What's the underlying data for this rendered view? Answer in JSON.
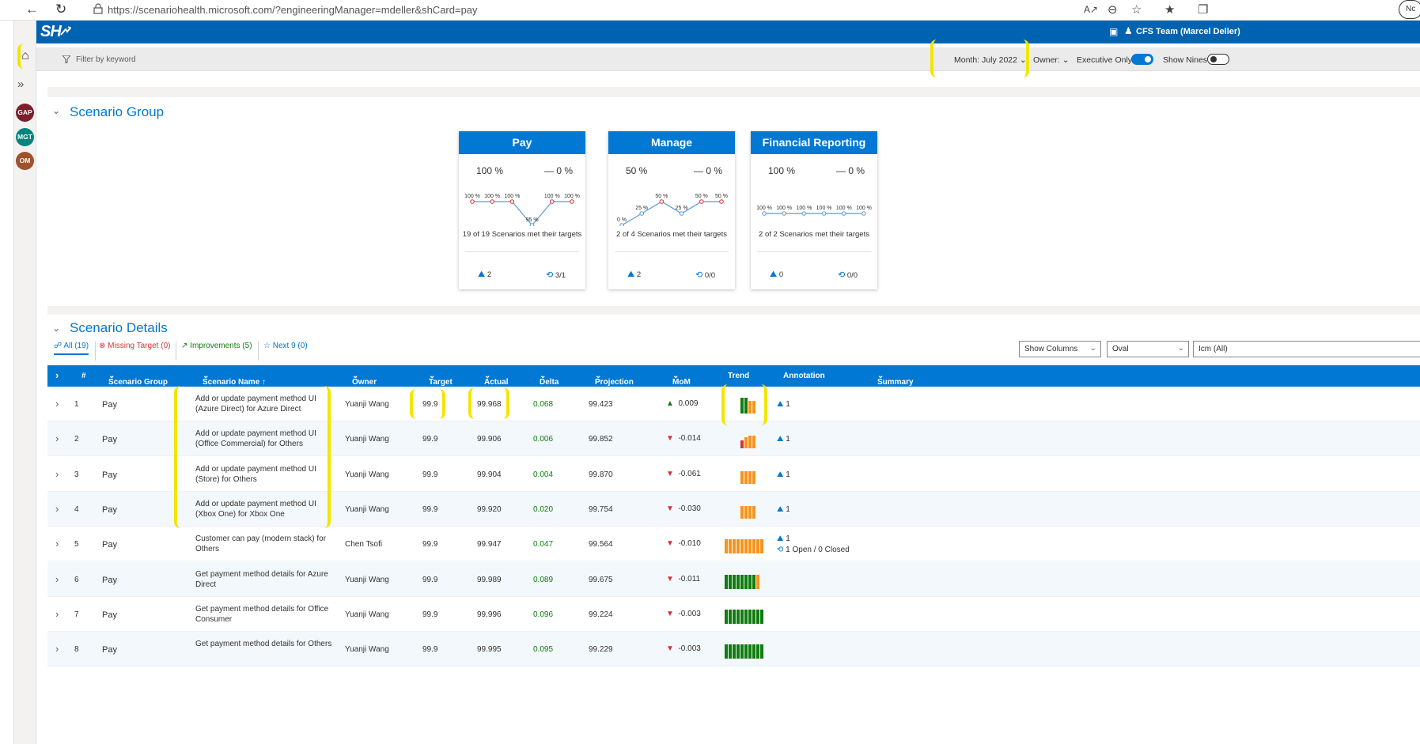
{
  "browser": {
    "url": "https://scenariohealth.microsoft.com/?engineeringManager=mdeller&shCard=pay",
    "profile_initial": "Nc"
  },
  "app": {
    "logo": "SH",
    "user": "CFS Team (Marcel Deller)"
  },
  "sidenav": {
    "badges": [
      {
        "label": "GAP",
        "color": "#7a1f2b"
      },
      {
        "label": "MGT",
        "color": "#00857c"
      },
      {
        "label": "OM",
        "color": "#a0522d"
      }
    ]
  },
  "filterbar": {
    "filter_placeholder": "Filter by keyword",
    "month": "Month: July 2022",
    "owner": "Owner:",
    "executive_only": "Executive Only",
    "executive_only_on": true,
    "show_nines": "Show Nines",
    "show_nines_on": false
  },
  "scenario_group": {
    "title": "Scenario Group",
    "cards": [
      {
        "title": "Pay",
        "left_pct": "100 %",
        "right_pct": "— 0 %",
        "points": [
          "100 %",
          "100 %",
          "100 %",
          "95 %",
          "100 %",
          "100 %"
        ],
        "met": "19 of 19 Scenarios met their targets",
        "annotations": "2",
        "incidents": "3/1"
      },
      {
        "title": "Manage",
        "left_pct": "50 %",
        "right_pct": "— 0 %",
        "points": [
          "0 %",
          "25 %",
          "50 %",
          "25 %",
          "50 %",
          "50 %"
        ],
        "met": "2 of 4 Scenarios met their targets",
        "annotations": "2",
        "incidents": "0/0"
      },
      {
        "title": "Financial Reporting",
        "left_pct": "100 %",
        "right_pct": "— 0 %",
        "points": [
          "100 %",
          "100 %",
          "100 %",
          "100 %",
          "100 %",
          "100 %"
        ],
        "met": "2 of 2 Scenarios met their targets",
        "annotations": "0",
        "incidents": "0/0"
      }
    ]
  },
  "scenario_details": {
    "title": "Scenario Details",
    "tabs": {
      "all": "All (19)",
      "missing": "Missing Target (0)",
      "improvements": "Improvements (5)",
      "next9": "Next 9 (0)"
    },
    "dropdowns": {
      "show_columns": "Show Columns",
      "oval": "Oval",
      "icm": "Icm (All)"
    },
    "headers": {
      "num": "#",
      "group": "Scenario Group",
      "name": "Scenario Name ↑",
      "owner": "Owner",
      "target": "Target",
      "actual": "Actual",
      "delta": "Delta",
      "projection": "Projection",
      "mom": "MoM",
      "trend": "Trend",
      "annotation": "Annotation",
      "summary": "Summary"
    },
    "rows": [
      {
        "num": "1",
        "group": "Pay",
        "name": "Add or update payment method UI (Azure Direct) for Azure Direct",
        "owner": "Yuanji Wang",
        "target": "99.9",
        "actual": "99.968",
        "delta": "0.068",
        "projection": "99.423",
        "mom": "0.009",
        "mom_dir": "up",
        "trend": [
          "g",
          "g",
          "o",
          "o"
        ],
        "annotation": "1",
        "incident": ""
      },
      {
        "num": "2",
        "group": "Pay",
        "name": "Add or update payment method UI (Office Commercial) for Others",
        "owner": "Yuanji Wang",
        "target": "99.9",
        "actual": "99.906",
        "delta": "0.006",
        "projection": "99.852",
        "mom": "-0.014",
        "mom_dir": "down",
        "trend": [
          "r",
          "o",
          "o",
          "o"
        ],
        "annotation": "1",
        "incident": ""
      },
      {
        "num": "3",
        "group": "Pay",
        "name": "Add or update payment method UI (Store) for Others",
        "owner": "Yuanji Wang",
        "target": "99.9",
        "actual": "99.904",
        "delta": "0.004",
        "projection": "99.870",
        "mom": "-0.061",
        "mom_dir": "down",
        "trend": [
          "o",
          "o",
          "o",
          "o"
        ],
        "annotation": "1",
        "incident": ""
      },
      {
        "num": "4",
        "group": "Pay",
        "name": "Add or update payment method UI (Xbox One) for Xbox One",
        "owner": "Yuanji Wang",
        "target": "99.9",
        "actual": "99.920",
        "delta": "0.020",
        "projection": "99.754",
        "mom": "-0.030",
        "mom_dir": "down",
        "trend": [
          "o",
          "o",
          "o",
          "o"
        ],
        "annotation": "1",
        "incident": ""
      },
      {
        "num": "5",
        "group": "Pay",
        "name": "Customer can pay (modern stack) for Others",
        "owner": "Chen Tsofi",
        "target": "99.9",
        "actual": "99.947",
        "delta": "0.047",
        "projection": "99.564",
        "mom": "-0.010",
        "mom_dir": "down",
        "trend": [
          "o",
          "o",
          "o",
          "o",
          "o",
          "o",
          "o",
          "o",
          "o",
          "o"
        ],
        "annotation": "1",
        "incident": "1 Open / 0 Closed"
      },
      {
        "num": "6",
        "group": "Pay",
        "name": "Get payment method details for Azure Direct",
        "owner": "Yuanji Wang",
        "target": "99.9",
        "actual": "99.989",
        "delta": "0.089",
        "projection": "99.675",
        "mom": "-0.011",
        "mom_dir": "down",
        "trend": [
          "g",
          "g",
          "g",
          "g",
          "g",
          "g",
          "g",
          "g",
          "o"
        ],
        "annotation": "",
        "incident": ""
      },
      {
        "num": "7",
        "group": "Pay",
        "name": "Get payment method details for Office Consumer",
        "owner": "Yuanji Wang",
        "target": "99.9",
        "actual": "99.996",
        "delta": "0.096",
        "projection": "99.224",
        "mom": "-0.003",
        "mom_dir": "down",
        "trend": [
          "g",
          "g",
          "g",
          "g",
          "g",
          "g",
          "g",
          "g",
          "g",
          "g"
        ],
        "annotation": "",
        "incident": ""
      },
      {
        "num": "8",
        "group": "Pay",
        "name": "Get payment method details for Others",
        "owner": "Yuanji Wang",
        "target": "99.9",
        "actual": "99.995",
        "delta": "0.095",
        "projection": "99.229",
        "mom": "-0.003",
        "mom_dir": "down",
        "trend": [
          "g",
          "g",
          "g",
          "g",
          "g",
          "g",
          "g",
          "g",
          "g",
          "g"
        ],
        "annotation": "",
        "incident": ""
      }
    ]
  },
  "colors": {
    "brand": "#0063b1",
    "accent": "#0078d4",
    "good": "#107c10",
    "warn": "#f7941d",
    "bad": "#d13438"
  }
}
